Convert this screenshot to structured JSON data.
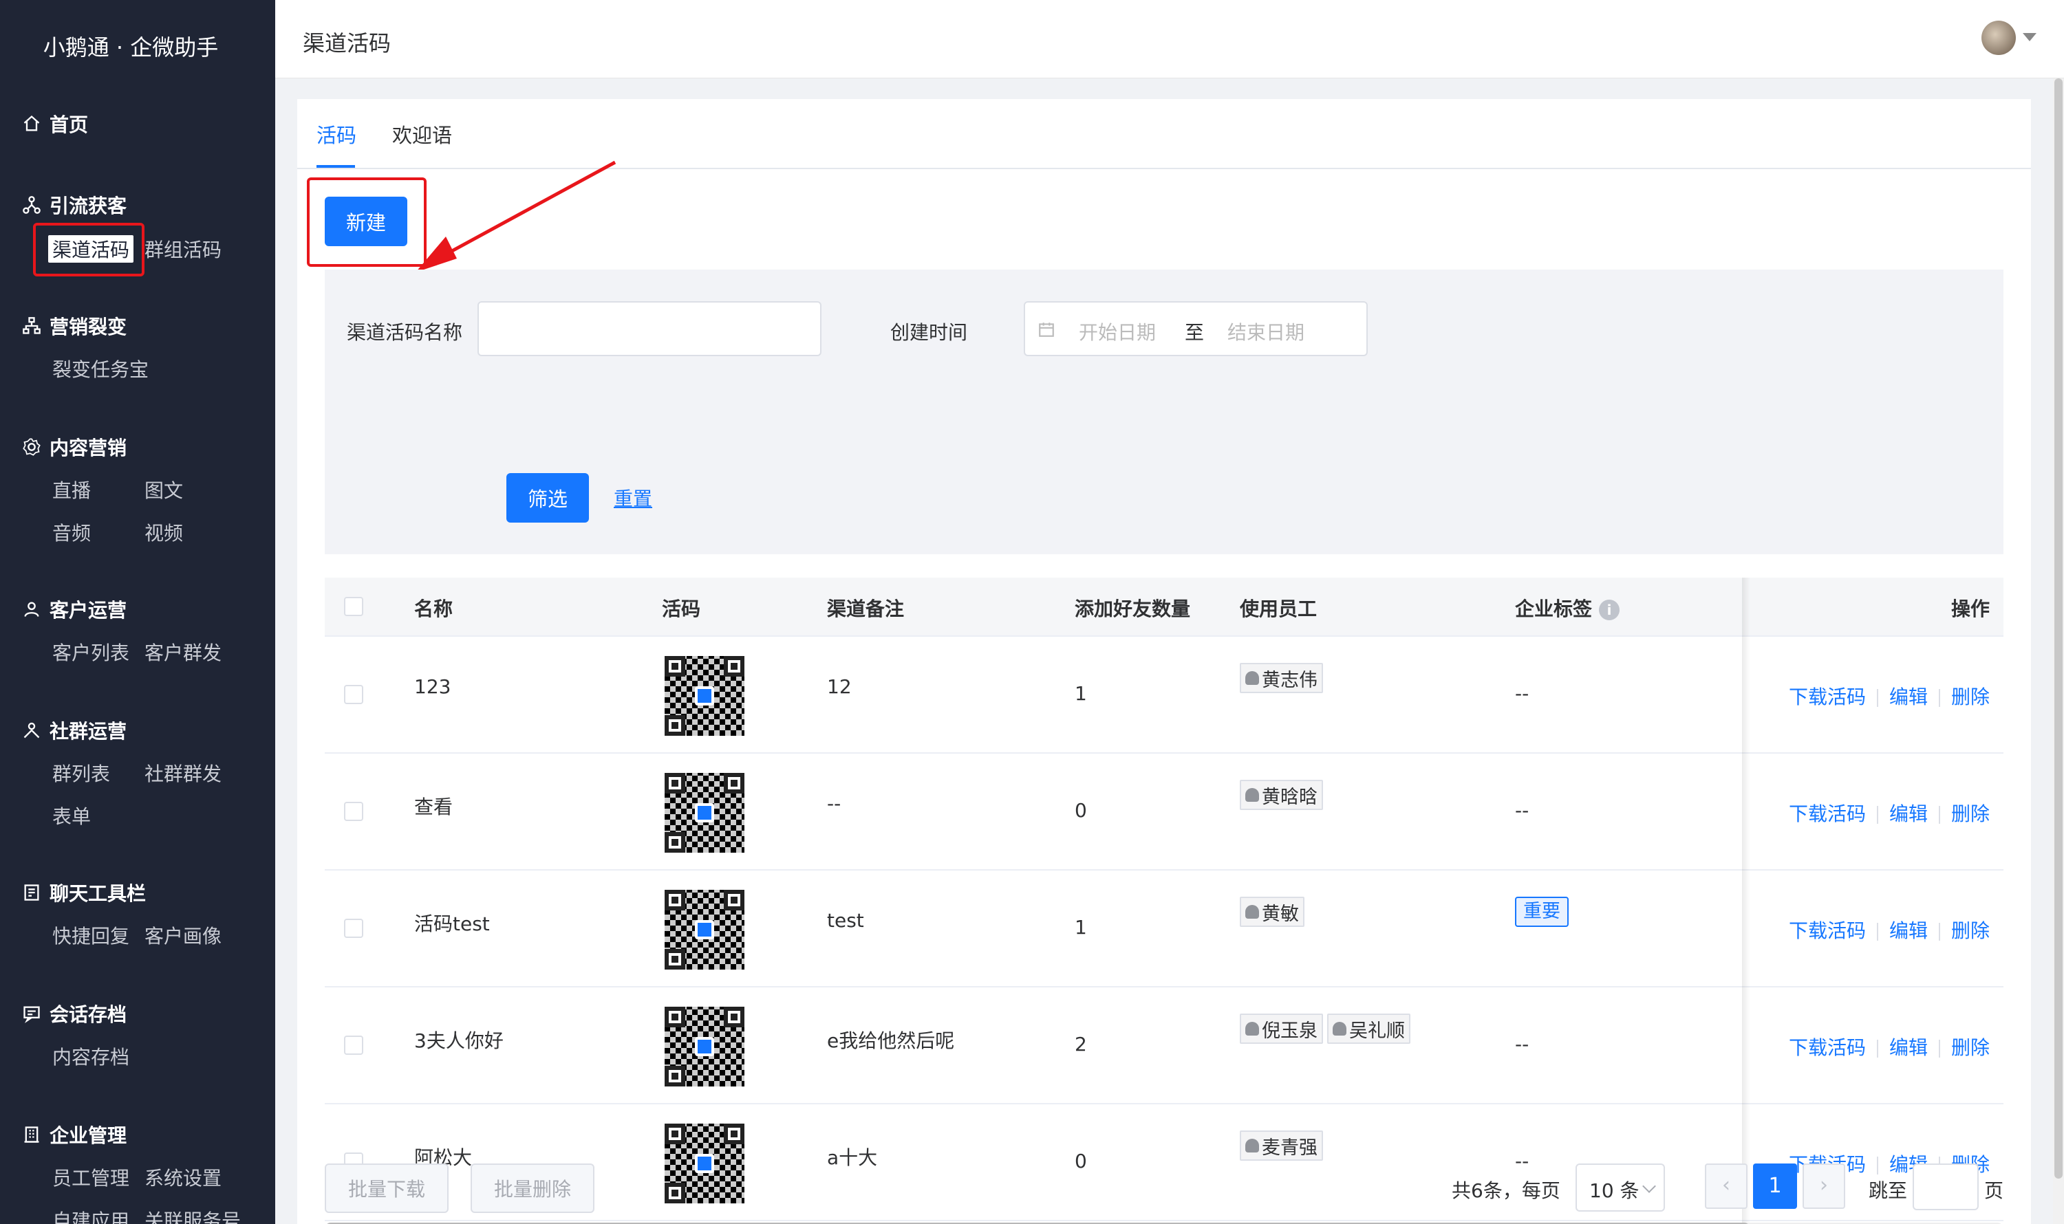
{
  "brand": "小鹅通 · 企微助手",
  "sidebar": {
    "home": "首页",
    "groups": [
      {
        "title": "引流获客",
        "items": [
          "渠道活码",
          "群组活码"
        ]
      },
      {
        "title": "营销裂变",
        "items": [
          "裂变任务宝"
        ]
      },
      {
        "title": "内容营销",
        "items": [
          "直播",
          "图文",
          "音频",
          "视频"
        ]
      },
      {
        "title": "客户运营",
        "items": [
          "客户列表",
          "客户群发"
        ]
      },
      {
        "title": "社群运营",
        "items": [
          "群列表",
          "社群群发",
          "表单"
        ]
      },
      {
        "title": "聊天工具栏",
        "items": [
          "快捷回复",
          "客户画像"
        ]
      },
      {
        "title": "会话存档",
        "items": [
          "内容存档"
        ]
      },
      {
        "title": "企业管理",
        "items": [
          "员工管理",
          "系统设置",
          "自建应用",
          "关联服务号"
        ]
      }
    ]
  },
  "header": {
    "title": "渠道活码"
  },
  "tabs": [
    "活码",
    "欢迎语"
  ],
  "toolbar": {
    "new_label": "新建"
  },
  "filter": {
    "name_label": "渠道活码名称",
    "name_value": "",
    "time_label": "创建时间",
    "start_placeholder": "开始日期",
    "range_sep": "至",
    "end_placeholder": "结束日期",
    "filter_button": "筛选",
    "reset_link": "重置"
  },
  "table": {
    "headers": [
      "名称",
      "活码",
      "渠道备注",
      "添加好友数量",
      "使用员工",
      "企业标签",
      "操作"
    ],
    "rows": [
      {
        "name": "123",
        "remark": "12",
        "friends": "1",
        "employees": [
          "黄志伟"
        ],
        "tag": "--"
      },
      {
        "name": "查看",
        "remark": "--",
        "friends": "0",
        "employees": [
          "黄晗晗"
        ],
        "tag": "--"
      },
      {
        "name": "活码test",
        "remark": "test",
        "friends": "1",
        "employees": [
          "黄敏"
        ],
        "tag": "重要"
      },
      {
        "name": "3夫人你好",
        "remark": "e我给他然后呢",
        "friends": "2",
        "employees": [
          "倪玉泉",
          "吴礼顺"
        ],
        "tag": "--"
      },
      {
        "name": "阿松大",
        "remark": "a十大",
        "friends": "0",
        "employees": [
          "麦青强"
        ],
        "tag": "--"
      }
    ],
    "actions": [
      "下载活码",
      "编辑",
      "删除"
    ]
  },
  "footer": {
    "batch_download": "批量下载",
    "batch_delete": "批量删除",
    "total_text": "共6条，每页",
    "page_size": "10 条",
    "current_page": "1",
    "jump_label": "跳至",
    "page_unit": "页",
    "prev": "‹",
    "next": "›"
  },
  "colors": {
    "primary": "#1677ff",
    "sidebar_bg": "#1f2535",
    "highlight_red": "#e8161b"
  }
}
